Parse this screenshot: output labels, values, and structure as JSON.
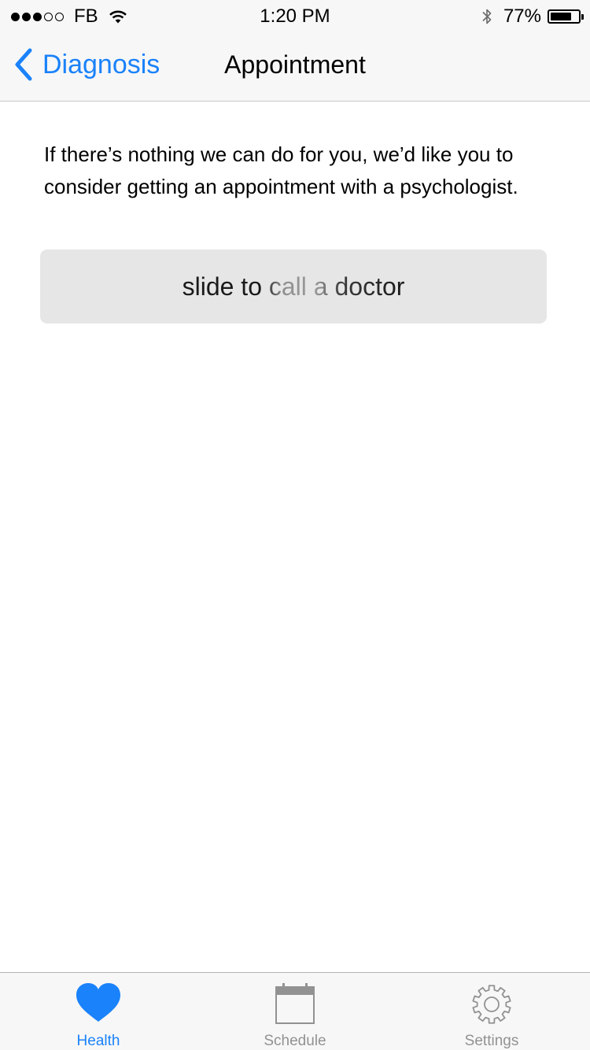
{
  "status_bar": {
    "carrier": "FB",
    "time": "1:20 PM",
    "battery_percent": "77%",
    "battery_level": 0.77,
    "signal_filled": 3,
    "signal_total": 5
  },
  "nav": {
    "back_label": "Diagnosis",
    "title": "Appointment"
  },
  "content": {
    "message": "If there’s nothing we can do for you, we’d like you to consider getting an appointment with a psychologist.",
    "slider_label": "slide to call a doctor"
  },
  "tab_bar": {
    "tabs": [
      {
        "label": "Health",
        "icon": "heart-icon",
        "active": true
      },
      {
        "label": "Schedule",
        "icon": "calendar-icon",
        "active": false
      },
      {
        "label": "Settings",
        "icon": "gear-icon",
        "active": false
      }
    ]
  },
  "colors": {
    "accent": "#1a82fb",
    "inactive": "#929292",
    "bar_background": "#f7f7f7",
    "slider_background": "#e6e6e6"
  }
}
